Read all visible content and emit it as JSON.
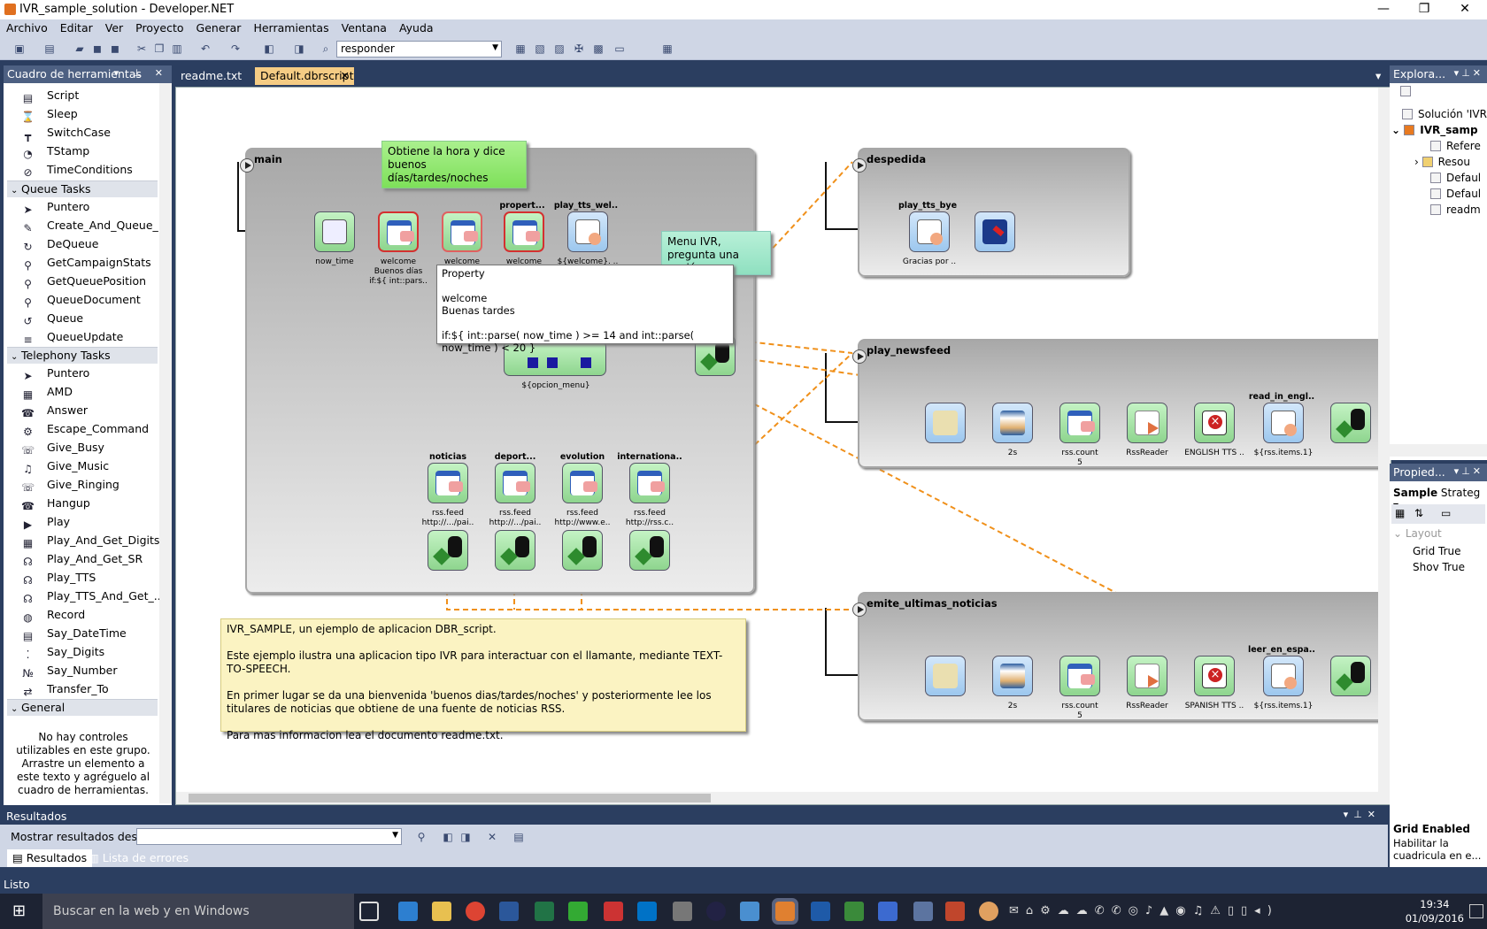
{
  "window": {
    "title": "IVR_sample_solution - Developer.NET",
    "minimize": "—",
    "maximize": "❐",
    "close": "✕"
  },
  "menu": [
    "Archivo",
    "Editar",
    "Ver",
    "Proyecto",
    "Generar",
    "Herramientas",
    "Ventana",
    "Ayuda"
  ],
  "toolbar": {
    "combo_value": "responder"
  },
  "toolbox": {
    "title": "Cuadro de herramientas",
    "top_items": [
      "Script",
      "Sleep",
      "SwitchCase",
      "TStamp",
      "TimeConditions"
    ],
    "queue_title": "Queue Tasks",
    "queue_items": [
      "Puntero",
      "Create_And_Queue_...",
      "DeQueue",
      "GetCampaignStats",
      "GetQueuePosition",
      "QueueDocument",
      "Queue",
      "QueueUpdate"
    ],
    "telephony_title": "Telephony Tasks",
    "telephony_items": [
      "Puntero",
      "AMD",
      "Answer",
      "Escape_Command",
      "Give_Busy",
      "Give_Music",
      "Give_Ringing",
      "Hangup",
      "Play",
      "Play_And_Get_Digits",
      "Play_And_Get_SR",
      "Play_TTS",
      "Play_TTS_And_Get_...",
      "Record",
      "Say_DateTime",
      "Say_Digits",
      "Say_Number",
      "Transfer_To"
    ],
    "general_title": "General",
    "empty_text": "No hay controles utilizables en este grupo. Arrastre un elemento a este texto y agréguelo al cuadro de herramientas."
  },
  "tabs": [
    {
      "label": "readme.txt",
      "active": false
    },
    {
      "label": "Default.dbrscript",
      "active": true
    }
  ],
  "canvas": {
    "groups": {
      "main": "main",
      "despedida": "despedida",
      "play_newsfeed": "play_newsfeed",
      "emite": "emite_ultimas_noticias"
    },
    "notes": {
      "green": "Obtiene la hora y dice buenos días/tardes/noches",
      "teal": "Menu IVR, pregunta una opción",
      "yellow": [
        "IVR_SAMPLE, un ejemplo de aplicacion DBR_script.",
        "Este ejemplo ilustra una aplicacion tipo IVR para interactuar con el llamante, mediante TEXT-TO-SPEECH.",
        "En primer lugar se da una bienvenida 'buenos dias/tardes/noches' y posteriormente lee los titulares de noticias que obtiene de una fuente de noticias RSS.",
        "Para mas informacion lea el documento readme.txt."
      ]
    },
    "tooltip": {
      "header": "Property",
      "line1": "welcome",
      "line2": "Buenas tardes",
      "line3": "if:${ int::parse( now_time ) >= 14 and int::parse( now_time ) < 20 }"
    },
    "main_nodes": {
      "now_time": "now_time",
      "w1a": "welcome",
      "w1b": "Buenos días",
      "w1c": "if:${ int::pars..",
      "w2a": "welcome",
      "w2b": "Buen",
      "w2c": "if:${",
      "p_title": "propert...",
      "w3a": "welcome",
      "tts_title": "play_tts_wel..",
      "tts_label": "${welcome}. ..",
      "menu_label": "${opcion_menu}",
      "noticias": "noticias",
      "deport": "deport...",
      "evolution": "evolution",
      "internac": "internationa..",
      "rss1": "rss.feed",
      "rss1b": "http://.../pai..",
      "rss2": "rss.feed",
      "rss2b": "http://.../pai..",
      "rss3": "rss.feed",
      "rss3b": "http://www.e..",
      "rss4": "rss.feed",
      "rss4b": "http://rss.c.."
    },
    "despedida_nodes": {
      "tts_title": "play_tts_bye",
      "tts_label": "Gracias por .."
    },
    "newsfeed_nodes": {
      "sleep": "2s",
      "rss_a": "rss.count",
      "rss_b": "5",
      "reader": "RssReader",
      "err": "ENGLISH TTS ..",
      "read_title": "read_in_engl..",
      "read_label": "${rss.items.1}"
    },
    "emite_nodes": {
      "sleep": "2s",
      "rss_a": "rss.count",
      "rss_b": "5",
      "reader": "RssReader",
      "err": "SPANISH TTS ..",
      "read_title": "leer_en_espa..",
      "read_label": "${rss.items.1}"
    }
  },
  "explorer": {
    "title": "Explora...",
    "items": [
      "Solución 'IVR",
      "IVR_samp",
      "Refere",
      "Resou",
      "Defaul",
      "Defaul",
      "readm"
    ]
  },
  "properties": {
    "title": "Propied...",
    "object": "Sample",
    "object_type": "Strateg",
    "category": "Layout",
    "rows": [
      {
        "name": "Grid",
        "value": "True"
      },
      {
        "name": "Shov",
        "value": "True"
      }
    ],
    "desc_title": "Grid Enabled",
    "desc_text": "Habilitar la cuadricula en e..."
  },
  "results": {
    "title": "Resultados",
    "show_from": "Mostrar resultados desde:",
    "tab1": "Resultados",
    "tab2": "Lista de errores"
  },
  "status": "Listo",
  "taskbar": {
    "search": "Buscar en la web y en Windows",
    "time": "19:34",
    "date": "01/09/2016"
  },
  "colors": {
    "accent": "#2b3e60",
    "node_green": "#8ed58e",
    "connector_orange": "#f0901a"
  }
}
